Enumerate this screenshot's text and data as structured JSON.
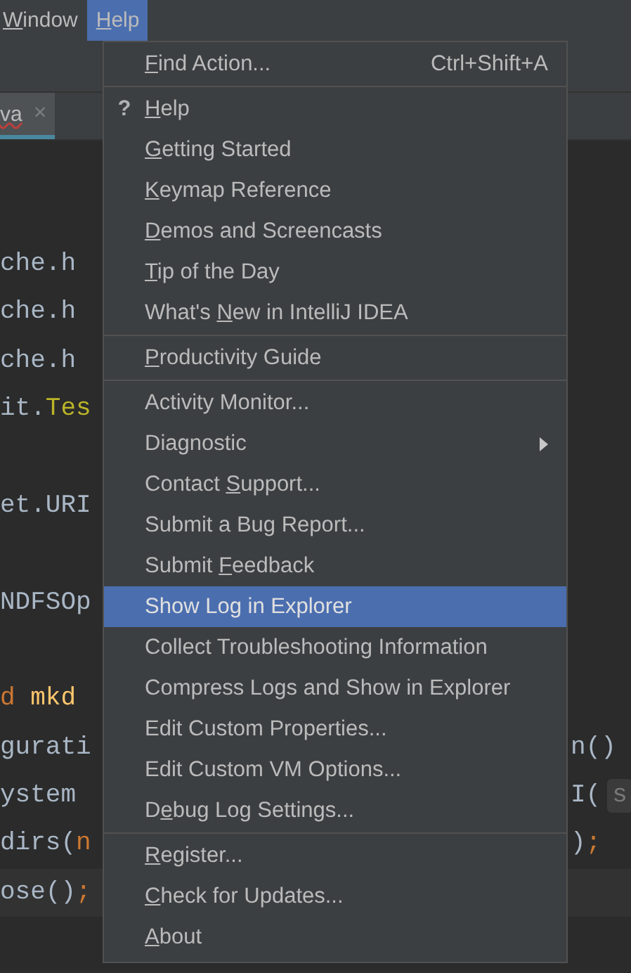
{
  "menubar": [
    {
      "mnemonic": "W",
      "label_rest": "indow",
      "selected": false
    },
    {
      "mnemonic": "H",
      "label_rest": "elp",
      "selected": true
    }
  ],
  "editor_tab": {
    "label": "va",
    "close": "×",
    "has_error": true
  },
  "code_lines": [
    {
      "left": [
        {
          "text": "che.h",
          "kind": "plain"
        }
      ]
    },
    {
      "left": [
        {
          "text": "che.h",
          "kind": "plain"
        }
      ]
    },
    {
      "left": [
        {
          "text": "che.h",
          "kind": "plain"
        }
      ]
    },
    {
      "left": [
        {
          "text": "it.",
          "kind": "plain"
        },
        {
          "text": "Tes",
          "kind": "annotation"
        }
      ]
    },
    {
      "blank_before": true,
      "left": [
        {
          "text": "et.URI",
          "kind": "plain"
        }
      ]
    },
    {
      "blank_before": true,
      "left": [
        {
          "text": "NDFSOp",
          "kind": "plain"
        }
      ]
    },
    {
      "blank_before": true,
      "left": [
        {
          "text": "d ",
          "kind": "keyword"
        },
        {
          "text": "mkd",
          "kind": "method"
        }
      ]
    },
    {
      "left": [
        {
          "text": "gurati",
          "kind": "plain"
        }
      ],
      "right": [
        {
          "text": "n()",
          "kind": "plain"
        }
      ]
    },
    {
      "left": [
        {
          "text": "ystem",
          "kind": "plain"
        }
      ],
      "right": [
        {
          "text": "I(",
          "kind": "plain"
        },
        {
          "text": "s",
          "kind": "hint"
        }
      ]
    },
    {
      "left": [
        {
          "text": "dirs(",
          "kind": "plain"
        },
        {
          "text": "n",
          "kind": "keyword"
        }
      ],
      "right": [
        {
          "text": ")",
          "kind": "plain"
        },
        {
          "text": ";",
          "kind": "keyword"
        }
      ]
    },
    {
      "left": [
        {
          "text": "ose()",
          "kind": "plain"
        },
        {
          "text": ";",
          "kind": "keyword"
        }
      ],
      "current": true
    }
  ],
  "menu": {
    "sections": [
      [
        {
          "mnemonic": "F",
          "label_rest": "ind Action...",
          "shortcut": "Ctrl+Shift+A",
          "selected": false
        }
      ],
      [
        {
          "icon_text": "?",
          "mnemonic": "H",
          "label_rest": "elp",
          "selected": false
        },
        {
          "mnemonic": "G",
          "label_rest": "etting Started",
          "selected": false
        },
        {
          "mnemonic": "K",
          "label_rest": "eymap Reference",
          "selected": false
        },
        {
          "mnemonic": "D",
          "label_rest": "emos and Screencasts",
          "selected": false
        },
        {
          "mnemonic": "T",
          "label_rest": "ip of the Day",
          "selected": false
        },
        {
          "label": "What's ",
          "mnemonic": "N",
          "label_rest": "ew in IntelliJ IDEA",
          "selected": false
        }
      ],
      [
        {
          "mnemonic": "P",
          "label_rest": "roductivity Guide",
          "selected": false
        }
      ],
      [
        {
          "label": "Activity Monitor...",
          "selected": false
        },
        {
          "label": "Diagnostic",
          "has_submenu": true,
          "selected": false
        },
        {
          "label": "Contact ",
          "mnemonic": "S",
          "label_rest": "upport...",
          "selected": false
        },
        {
          "label": "Submit a Bug Report...",
          "selected": false
        },
        {
          "label": "Submit ",
          "mnemonic": "F",
          "label_rest": "eedback",
          "selected": false
        },
        {
          "label": "Show Log in Explorer",
          "selected": true
        },
        {
          "label": "Collect Troubleshooting Information",
          "selected": false
        },
        {
          "label": "Compress Logs and Show in Explorer",
          "selected": false
        },
        {
          "label": "Edit Custom Properties...",
          "selected": false
        },
        {
          "label": "Edit Custom VM Options...",
          "selected": false
        },
        {
          "label": "D",
          "mnemonic": "e",
          "label_rest": "bug Log Settings...",
          "selected": false
        }
      ],
      [
        {
          "mnemonic": "R",
          "label_rest": "egister...",
          "selected": false
        },
        {
          "mnemonic": "C",
          "label_rest": "heck for Updates...",
          "selected": false
        },
        {
          "mnemonic": "A",
          "label_rest": "bout",
          "selected": false
        }
      ]
    ]
  }
}
